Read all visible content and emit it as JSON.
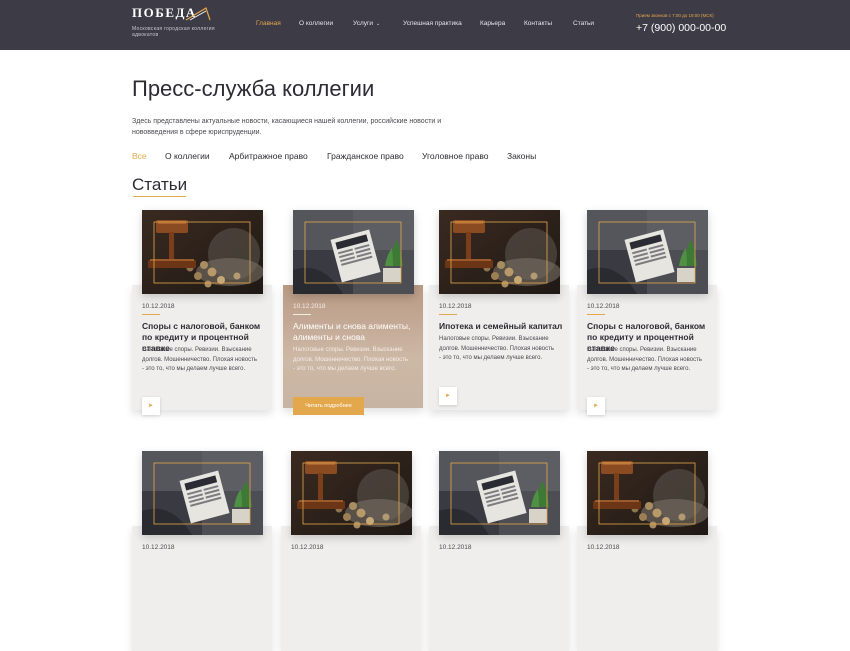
{
  "header": {
    "logo_name": "ПОБЕДА",
    "logo_sub": "Московская городская коллегия адвокатов",
    "nav": [
      {
        "label": "Главная",
        "active": true
      },
      {
        "label": "О коллегии",
        "active": false
      },
      {
        "label": "Услуги",
        "active": false,
        "dropdown": true
      },
      {
        "label": "Успешная практика",
        "active": false
      },
      {
        "label": "Карьера",
        "active": false
      },
      {
        "label": "Контакты",
        "active": false
      },
      {
        "label": "Статьи",
        "active": false
      }
    ],
    "hours": "Прием звонков с 7:00 до 19:00 (МСК)",
    "phone": "+7 (900) 000-00-00"
  },
  "page": {
    "title": "Пресс-служба коллегии",
    "description": "Здесь представлены актуальные новости, касающиеся нашей коллегии, российские новости и нововведения в сфере юриспруденции."
  },
  "filters": [
    {
      "label": "Все",
      "active": true
    },
    {
      "label": "О коллегии",
      "active": false
    },
    {
      "label": "Арбитражное право",
      "active": false
    },
    {
      "label": "Гражданское право",
      "active": false
    },
    {
      "label": "Уголовное право",
      "active": false
    },
    {
      "label": "Законы",
      "active": false
    }
  ],
  "section_title": "Статьи",
  "cards": [
    {
      "date": "10.12.2018",
      "title": "Споры с налоговой, банком по кредиту и процентной ставке",
      "text": "Налоговые споры. Ревизии. Взыскание долгов. Мошенничество. Плохая новость - это то, что мы делаем лучше всего.",
      "image": "gavel-coins-icon",
      "button_icon": "arrow-right-icon"
    },
    {
      "date": "10.12.2018",
      "title": "Алименты и снова алименты, алименты и снова",
      "text": "Налоговые споры. Ревизии. Взыскание долгов. Мошенничество. Плохая новость - это то, что мы делаем лучше всего.",
      "image": "newspaper-icon",
      "button_label": "Читать подробнее",
      "hovered": true
    },
    {
      "date": "10.12.2018",
      "title": "Ипотека и семейный капитал",
      "text": "Налоговые споры. Ревизии. Взыскание долгов. Мошенничество. Плохая новость - это то, что мы делаем лучше всего.",
      "image": "gavel-coins-icon",
      "button_icon": "arrow-right-icon"
    },
    {
      "date": "10.12.2018",
      "title": "Споры с налоговой, банком по кредиту и процентной ставке",
      "text": "Налоговые споры. Ревизии. Взыскание долгов. Мошенничество. Плохая новость - это то, что мы делаем лучше всего.",
      "image": "newspaper-icon",
      "button_icon": "arrow-right-icon"
    },
    {
      "date": "10.12.2018",
      "image": "newspaper-icon"
    },
    {
      "date": "10.12.2018",
      "image": "gavel-coins-icon"
    },
    {
      "date": "10.12.2018",
      "image": "newspaper-icon"
    },
    {
      "date": "10.12.2018",
      "image": "gavel-coins-icon"
    }
  ],
  "colors": {
    "header_bg": "#3d3b46",
    "accent": "#e4a84c",
    "card_bg": "#efeeec",
    "text_dark": "#2d2c35"
  }
}
